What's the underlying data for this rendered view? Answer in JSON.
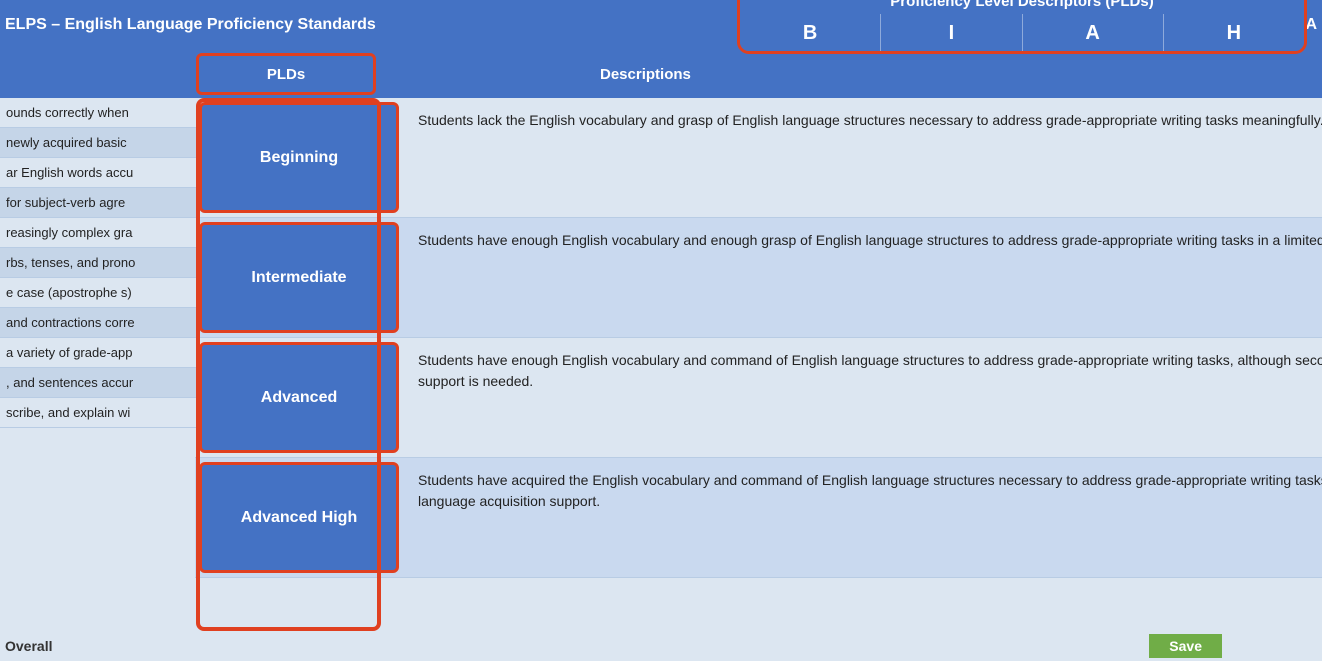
{
  "page": {
    "title": "ELPS – English Language Proficiency Standards",
    "right_label": "A"
  },
  "header": {
    "pld_section_title": "Proficiency Level Descriptors (PLDs)",
    "pld_letters": [
      "B",
      "I",
      "A",
      "H"
    ]
  },
  "columns": {
    "plds_label": "PLDs",
    "descriptions_label": "Descriptions"
  },
  "rows": [
    {
      "pld": "Beginning",
      "description": "Students lack the English vocabulary and grasp of English language structures necessary to address grade-appropriate writing tasks meaningfully."
    },
    {
      "pld": "Intermediate",
      "description": "Students have enough English vocabulary and enough grasp of English language structures to address grade-appropriate writing tasks in a limited way."
    },
    {
      "pld": "Advanced",
      "description": "Students have enough English vocabulary and command of English language structures to address grade-appropriate writing tasks, although second language acquisition support is needed."
    },
    {
      "pld": "Advanced High",
      "description": "Students have acquired the English vocabulary and command of English language structures necessary to address grade-appropriate writing tasks with minimal second language acquisition support."
    }
  ],
  "left_partial_rows": [
    "ounds correctly when",
    "newly acquired basic",
    "ar English words accu",
    "for subject-verb agre",
    "reasingly complex gra",
    "rbs, tenses, and prono",
    "e case (apostrophe s)",
    "and contractions corre",
    "a variety of grade-app",
    ", and sentences accur",
    "scribe, and explain wi"
  ],
  "bottom": {
    "overall_label": "Overall",
    "save_label": "Save"
  }
}
